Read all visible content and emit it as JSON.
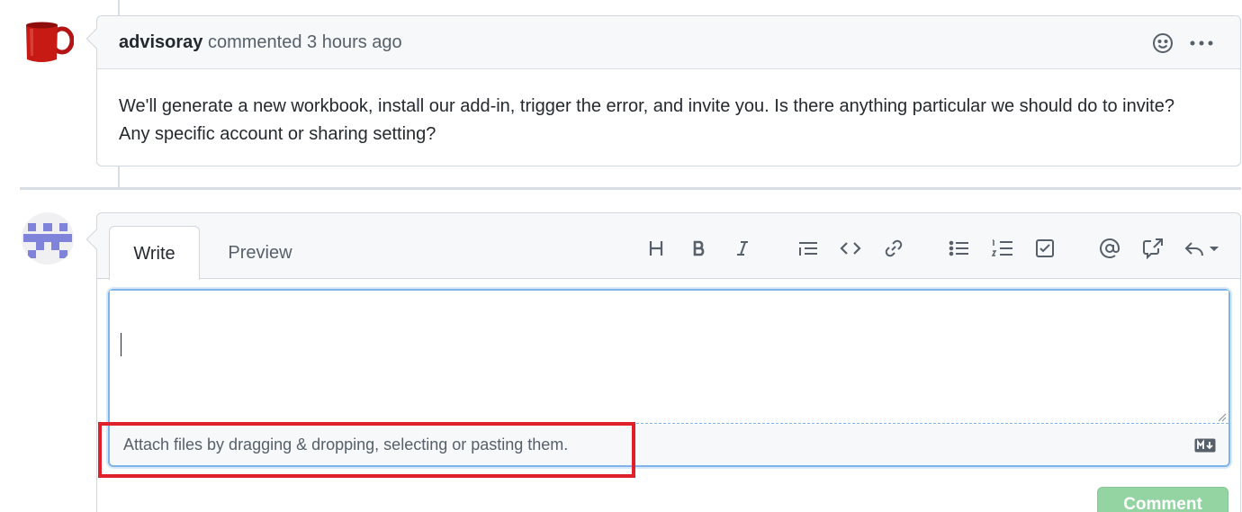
{
  "comment": {
    "author": "advisoray",
    "action": "commented",
    "time_ago": "3 hours ago",
    "body": "We'll generate a new workbook, install our add-in, trigger the error, and invite you. Is there anything particular we should do to invite? Any specific account or sharing setting?",
    "icons": [
      "smiley-icon",
      "kebab-menu-icon"
    ]
  },
  "form": {
    "tabs": [
      {
        "label": "Write",
        "active": true
      },
      {
        "label": "Preview",
        "active": false
      }
    ],
    "toolbar": [
      "heading-icon",
      "bold-icon",
      "italic-icon",
      "quote-icon",
      "code-icon",
      "link-icon",
      "unordered-list-icon",
      "ordered-list-icon",
      "task-list-icon",
      "mention-icon",
      "cross-reference-icon",
      "saved-replies-icon"
    ],
    "textarea_value": "",
    "attach_text": "Attach files by dragging & dropping, selecting or pasting them.",
    "submit_label": "Comment"
  },
  "colors": {
    "highlight": "#e0202a",
    "focus_border": "#7eb4ea",
    "submit_disabled": "#94d3a2"
  }
}
